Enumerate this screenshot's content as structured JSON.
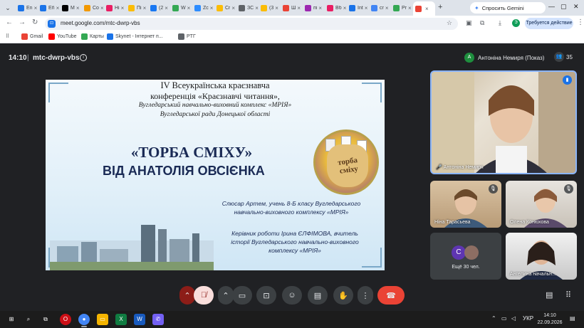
{
  "browser": {
    "tabs": [
      {
        "label": "En",
        "color": "#1a73e8"
      },
      {
        "label": "Eñ",
        "color": "#1a73e8"
      },
      {
        "label": "M",
        "color": "#000000"
      },
      {
        "label": "Co",
        "color": "#f29900"
      },
      {
        "label": "Hi",
        "color": "#e91e63"
      },
      {
        "label": "Пі",
        "color": "#fbbc04"
      },
      {
        "label": "(2",
        "color": "#1877f2"
      },
      {
        "label": "W",
        "color": "#34a853"
      },
      {
        "label": "Zc",
        "color": "#2d8cff"
      },
      {
        "label": "Cr",
        "color": "#fbbc04"
      },
      {
        "label": "ЗС",
        "color": "#5f6368"
      },
      {
        "label": "(3",
        "color": "#fbbc04"
      },
      {
        "label": "Ш",
        "color": "#ea4335"
      },
      {
        "label": "пі",
        "color": "#9c27b0"
      },
      {
        "label": "Вб",
        "color": "#e91e63"
      },
      {
        "label": "Int",
        "color": "#1a73e8"
      },
      {
        "label": "cr",
        "color": "#4285f4"
      },
      {
        "label": "Pr",
        "color": "#34a853"
      },
      {
        "label": "",
        "color": "#ea4335",
        "active": true
      }
    ],
    "gemini_label": "Спросить Gemini",
    "url": "meet.google.com/mtc-dwrp-vbs",
    "action_required": "Требуется действие",
    "profile_initial": "Э",
    "bookmarks": [
      {
        "label": "Gmail",
        "color": "#ea4335"
      },
      {
        "label": "YouTube",
        "color": "#ff0000"
      },
      {
        "label": "Карты",
        "color": "#34a853"
      },
      {
        "label": "Skynet - Інтернет п...",
        "color": "#1a73e8"
      },
      {
        "label": "PTГ",
        "color": "#5f6368"
      }
    ]
  },
  "meet": {
    "time": "14:10",
    "separator": "|",
    "meeting_code": "mtc-dwrp-vbs",
    "presenter_initial": "A",
    "presenter_label": "Антоніна Немиря (Показ)",
    "participants_count": "35",
    "slide": {
      "line1": "IV Всеукраїнська краєзнавча",
      "line2": "конференція «Краєзнавчі читання»,",
      "line3": "Вугледарський навчально-виховний комплекс «МРІЯ»",
      "line4": "Вугледарської ради Донецької області",
      "title": "«ТОРБА СМІХУ»",
      "subtitle": "ВІД АНАТОЛІЯ ОВСІЄНКА",
      "bag_text_1": "торба",
      "bag_text_2": "сміху",
      "author_1": "Слюсар Артем, учень 8-Б класу Вугледарського",
      "author_2": "навчально-виховного комплексу «МРІЯ»",
      "supervisor_1": "Керівник роботи Ірина ЄЛФІМОВА, вчитель",
      "supervisor_2": "історії Вугледарського навчально-виховного",
      "supervisor_3": "комплексу «МРІЯ»"
    },
    "participants": {
      "main": "Антоніна Немиря",
      "tile2": "Ніна Тарасьева",
      "tile3": "Олена Конюхова",
      "more_initial": "С",
      "more_label": "Ещё 30 чел.",
      "tile5": "Ангелина начальн..."
    }
  },
  "taskbar": {
    "lang": "УКР",
    "time": "14:10",
    "date": "22.09.2026"
  }
}
